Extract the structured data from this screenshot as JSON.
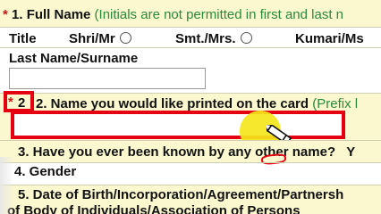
{
  "section1": {
    "star": "*",
    "title": "1. Full Name",
    "note": "(Initials are not permitted in first and last n"
  },
  "title_row": {
    "label": "Title",
    "options": [
      "Shri/Mr",
      "Smt./Mrs.",
      "Kumari/Ms"
    ]
  },
  "last_name": {
    "label": "Last Name/Surname",
    "value": ""
  },
  "section2": {
    "star": "*",
    "title": "2. Name you would like printed on the card",
    "note": "(Prefix l",
    "value": ""
  },
  "section3": {
    "title": "3. Have you ever been known by any other name?",
    "trailing": "Y"
  },
  "section4": {
    "title": "4. Gender"
  },
  "section5": {
    "line1": "5. Date of Birth/Incorporation/Agreement/Partnersh",
    "line2": "of Body of Individuals/Association of Persons"
  },
  "colors": {
    "highlight": "#e50012",
    "cursor_halo": "#f5e61a",
    "note_green": "#2a8a3a",
    "shade": "#fbf8cf"
  }
}
